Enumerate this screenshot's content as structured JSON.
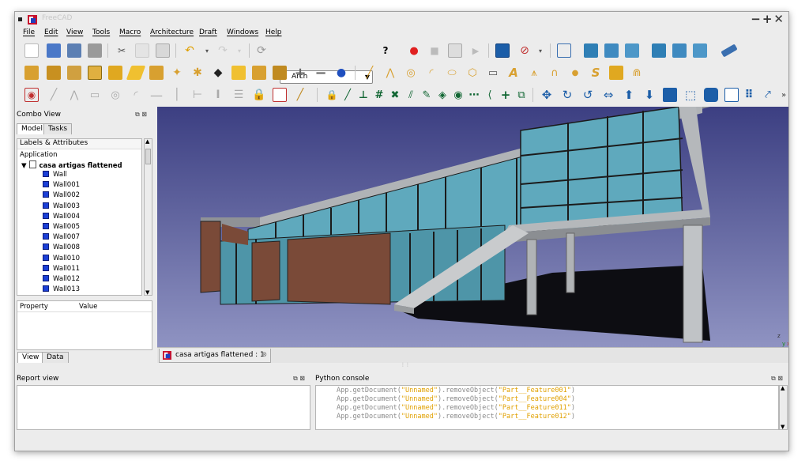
{
  "window": {
    "title": "FreeCAD"
  },
  "menu": [
    "File",
    "Edit",
    "View",
    "Tools",
    "Macro",
    "Architecture",
    "Draft",
    "Windows",
    "Help"
  ],
  "workbench": {
    "selected": "Arch"
  },
  "combo_view": {
    "title": "Combo View",
    "tabs": [
      "Model",
      "Tasks"
    ],
    "tree_header": "Labels & Attributes",
    "root": "Application",
    "document": "casa artigas flattened",
    "items": [
      "Wall",
      "Wall001",
      "Wall002",
      "Wall003",
      "Wall004",
      "Wall005",
      "Wall007",
      "Wall008",
      "Wall010",
      "Wall011",
      "Wall012",
      "Wall013"
    ],
    "property_col": "Property",
    "value_col": "Value",
    "bottom_tabs": [
      "View",
      "Data"
    ]
  },
  "document_tab": "casa artigas flattened : 1",
  "report_view": {
    "title": "Report view"
  },
  "python_console": {
    "title": "Python console",
    "lines": [
      {
        "prefix": "App.getDocument(",
        "doc": "\"Unnamed\"",
        "mid": ").removeObject(",
        "obj": "\"Part__Feature001\"",
        "suffix": ")"
      },
      {
        "prefix": "App.getDocument(",
        "doc": "\"Unnamed\"",
        "mid": ").removeObject(",
        "obj": "\"Part__Feature004\"",
        "suffix": ")"
      },
      {
        "prefix": "App.getDocument(",
        "doc": "\"Unnamed\"",
        "mid": ").removeObject(",
        "obj": "\"Part__Feature011\"",
        "suffix": ")"
      },
      {
        "prefix": "App.getDocument(",
        "doc": "\"Unnamed\"",
        "mid": ").removeObject(",
        "obj": "\"Part__Feature012\"",
        "suffix": ")"
      }
    ]
  },
  "axis_labels": {
    "z": "z",
    "x": "x",
    "y": "y"
  },
  "colors": {
    "viewport_bg": "#4d4f8f",
    "glass": "#5fa9bd",
    "brick": "#7a4a38",
    "wall_icon": "#1b3fd6"
  }
}
